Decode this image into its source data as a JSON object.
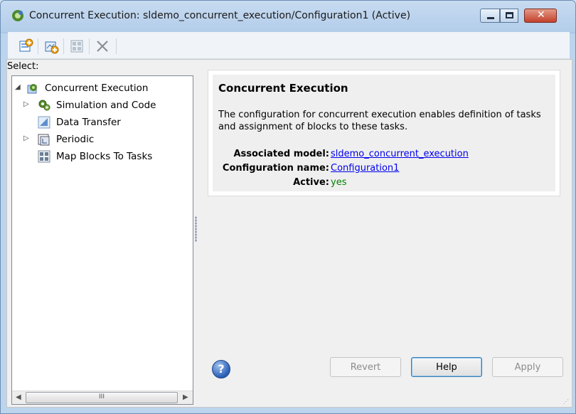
{
  "window": {
    "title": "Concurrent Execution: sldemo_concurrent_execution/Configuration1 (Active)",
    "close_glyph": "✕"
  },
  "toolbar": {
    "icons": [
      "add-task-icon",
      "add-periodic-icon",
      "map-blocks-icon",
      "delete-icon"
    ]
  },
  "tree": {
    "label": "Select:",
    "items": [
      {
        "label": "Concurrent Execution",
        "icon": "concurrent-execution-icon",
        "expander": "◢"
      },
      {
        "label": "Simulation and Code",
        "icon": "simulation-gears-icon",
        "expander": "▷"
      },
      {
        "label": "Data Transfer",
        "icon": "data-transfer-icon",
        "expander": ""
      },
      {
        "label": "Periodic",
        "icon": "periodic-icon",
        "expander": "▷"
      },
      {
        "label": "Map Blocks To Tasks",
        "icon": "map-blocks-icon",
        "expander": ""
      }
    ],
    "scroll_left": "◀",
    "scroll_right": "▶",
    "scroll_grip": "III"
  },
  "panel": {
    "title": "Concurrent Execution",
    "description": "The configuration for concurrent execution enables definition of tasks and assignment of blocks to these tasks.",
    "associated_model_label": "Associated model:",
    "associated_model_value": "sldemo_concurrent_execution",
    "configuration_name_label": "Configuration name:",
    "configuration_name_value": "Configuration1",
    "active_label": "Active:",
    "active_value": "yes"
  },
  "buttons": {
    "help_glyph": "?",
    "revert": "Revert",
    "help": "Help",
    "apply": "Apply"
  },
  "colors": {
    "link": "#0000ee",
    "active_value": "#008000",
    "close_button": "#c2412b"
  }
}
